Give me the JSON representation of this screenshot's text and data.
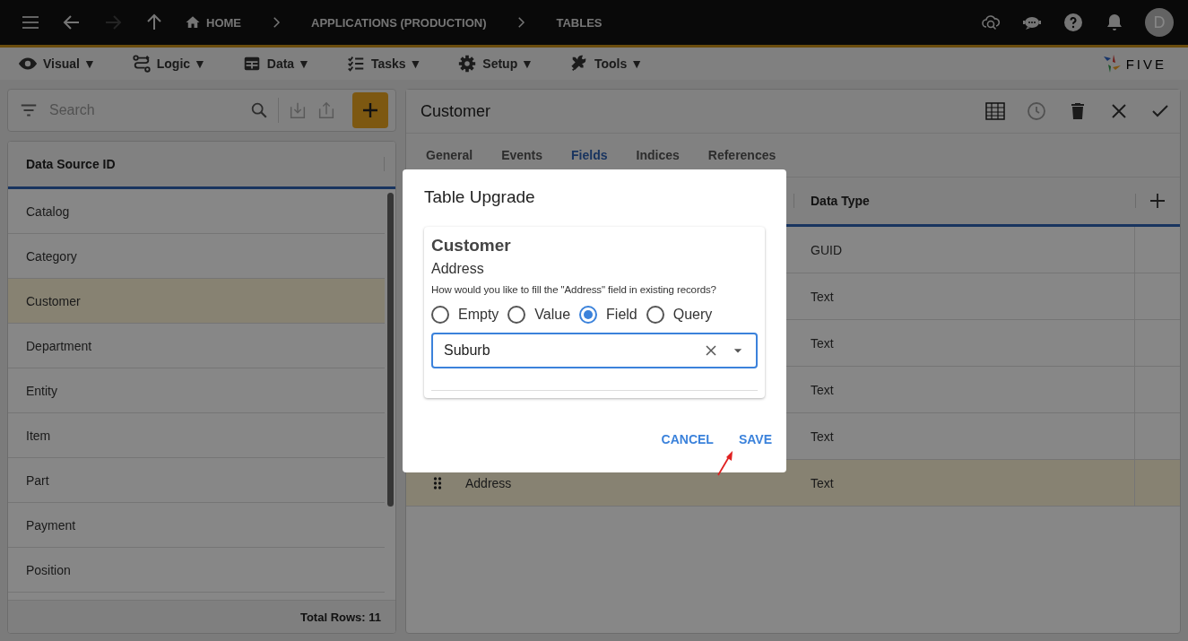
{
  "top_bar": {
    "breadcrumbs": [
      {
        "label": "HOME",
        "kind": "home"
      },
      {
        "label": "APPLICATIONS (PRODUCTION)",
        "kind": "plain"
      },
      {
        "label": "TABLES",
        "kind": "plain"
      }
    ],
    "avatar": "D"
  },
  "menu": [
    "Visual ▼",
    "Logic ▼",
    "Data ▼",
    "Tasks ▼",
    "Setup ▼",
    "Tools ▼"
  ],
  "logo": "FIVE",
  "left_panel": {
    "search": {
      "placeholder": "Search"
    },
    "column": "Data Source ID",
    "rows": [
      {
        "label": "Catalog",
        "selected": false
      },
      {
        "label": "Category",
        "selected": false
      },
      {
        "label": "Customer",
        "selected": true
      },
      {
        "label": "Department",
        "selected": false
      },
      {
        "label": "Entity",
        "selected": false
      },
      {
        "label": "Item",
        "selected": false
      },
      {
        "label": "Part",
        "selected": false
      },
      {
        "label": "Payment",
        "selected": false
      },
      {
        "label": "Position",
        "selected": false
      }
    ],
    "footer": "Total Rows: 11"
  },
  "record": {
    "title": "Customer",
    "tabs": [
      {
        "label": "General",
        "selected": false
      },
      {
        "label": "Events",
        "selected": false
      },
      {
        "label": "Fields",
        "selected": true
      },
      {
        "label": "Indices",
        "selected": false
      },
      {
        "label": "References",
        "selected": false
      }
    ],
    "column": "Data Type",
    "rows": [
      {
        "data_type": "GUID",
        "selected": false
      },
      {
        "data_type": "Text",
        "selected": false
      },
      {
        "data_type": "Text",
        "selected": false
      },
      {
        "data_type": "Text",
        "selected": false
      },
      {
        "data_type": "Text",
        "selected": false
      },
      {
        "field": "Address",
        "data_type": "Text",
        "selected": true
      }
    ]
  },
  "dialog": {
    "title": "Table Upgrade",
    "table": "Customer",
    "field": "Address",
    "question": "How would you like to fill the \"Address\" field in existing records?",
    "options": [
      {
        "label": "Empty",
        "selected": false
      },
      {
        "label": "Value",
        "selected": false
      },
      {
        "label": "Field",
        "selected": true
      },
      {
        "label": "Query",
        "selected": false
      }
    ],
    "select": {
      "value": "Suburb"
    },
    "buttons": [
      "CANCEL",
      "SAVE"
    ]
  }
}
